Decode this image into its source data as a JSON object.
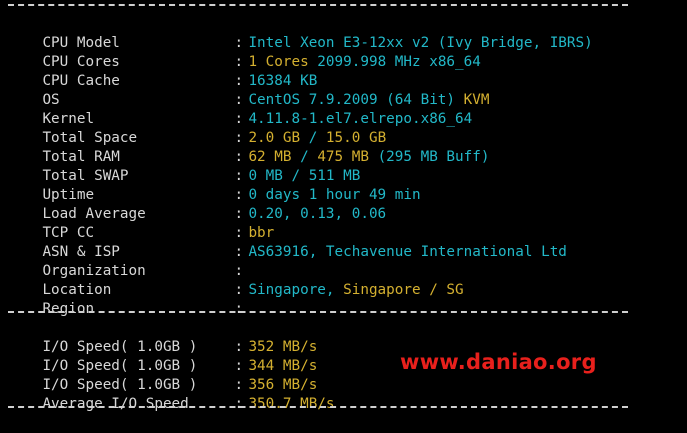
{
  "rows": [
    {
      "label": "CPU Model",
      "colon": ":",
      "v1": "Intel Xeon E3-12xx v2 (Ivy Bridge, IBRS)",
      "v1_color": "#22b8c8"
    },
    {
      "label": "CPU Cores",
      "colon": ":",
      "v1": "1 Cores",
      "v1_color": "#d4b030",
      "v2": " 2099.998 MHz x86_64",
      "v2_color": "#22b8c8"
    },
    {
      "label": "CPU Cache",
      "colon": ":",
      "v1": "16384 KB",
      "v1_color": "#22b8c8"
    },
    {
      "label": "OS",
      "colon": ":",
      "v1": "CentOS 7.9.2009 (64 Bit)",
      "v1_color": "#22b8c8",
      "v2": " KVM",
      "v2_color": "#d4b030"
    },
    {
      "label": "Kernel",
      "colon": ":",
      "v1": "4.11.8-1.el7.elrepo.x86_64",
      "v1_color": "#22b8c8"
    },
    {
      "label": "Total Space",
      "colon": ":",
      "v1": "2.0 GB",
      "v1_color": "#d4b030",
      "v2": " / ",
      "v2_color": "#22b8c8",
      "v3": "15.0 GB",
      "v3_color": "#d4b030"
    },
    {
      "label": "Total RAM",
      "colon": ":",
      "v1": "62 MB",
      "v1_color": "#d4b030",
      "v2": " / ",
      "v2_color": "#22b8c8",
      "v3": "475 MB",
      "v3_color": "#d4b030",
      "v4": " (295 MB Buff)",
      "v4_color": "#22b8c8"
    },
    {
      "label": "Total SWAP",
      "colon": ":",
      "v1": "0 MB / 511 MB",
      "v1_color": "#22b8c8"
    },
    {
      "label": "Uptime",
      "colon": ":",
      "v1": "0 days 1 hour 49 min",
      "v1_color": "#22b8c8"
    },
    {
      "label": "Load Average",
      "colon": ":",
      "v1": "0.20, 0.13, 0.06",
      "v1_color": "#22b8c8"
    },
    {
      "label": "TCP CC",
      "colon": ":",
      "v1": "bbr",
      "v1_color": "#d4b030"
    },
    {
      "label": "ASN & ISP",
      "colon": ":",
      "v1": "AS63916, Techavenue International Ltd",
      "v1_color": "#22b8c8"
    },
    {
      "label": "Organization",
      "colon": ":",
      "v1": "",
      "v1_color": "#22b8c8"
    },
    {
      "label": "Location",
      "colon": ":",
      "v1": "Singapore,",
      "v1_color": "#22b8c8",
      "v2": " Singapore / SG",
      "v2_color": "#d4b030"
    },
    {
      "label": "Region",
      "colon": ":",
      "v1": "",
      "v1_color": "#22b8c8"
    }
  ],
  "io_rows": [
    {
      "label": "I/O Speed( 1.0GB )",
      "colon": ":",
      "v1": "352 MB/s",
      "v1_color": "#d4b030"
    },
    {
      "label": "I/O Speed( 1.0GB )",
      "colon": ":",
      "v1": "344 MB/s",
      "v1_color": "#d4b030"
    },
    {
      "label": "I/O Speed( 1.0GB )",
      "colon": ":",
      "v1": "356 MB/s",
      "v1_color": "#d4b030"
    },
    {
      "label": "Average I/O Speed",
      "colon": ":",
      "v1": "350.7 MB/s",
      "v1_color": "#d4b030"
    }
  ],
  "watermark": {
    "text": "www.daniao.org",
    "color": "#e8201c"
  },
  "colors": {
    "background": "#000000",
    "label": "#d8d8d8",
    "cyan": "#22b8c8",
    "yellow": "#d4b030"
  }
}
